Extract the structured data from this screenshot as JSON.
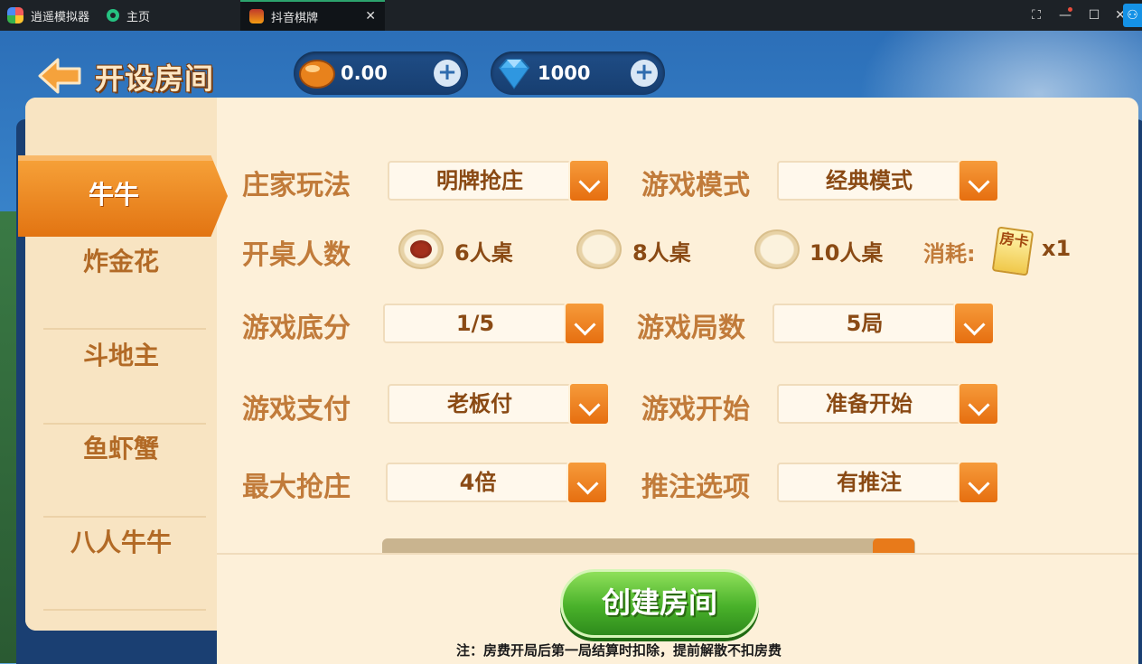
{
  "emulator": {
    "app_name": "逍遥模拟器",
    "tabs": [
      {
        "label": "主页"
      },
      {
        "label": "抖音棋牌"
      }
    ],
    "close_glyph": "✕",
    "window_controls": {
      "fullscreen": "⛶",
      "minimize": "—",
      "maximize": "☐",
      "close": "✕",
      "side": "⚇"
    }
  },
  "header": {
    "title": "开设房间",
    "beans": {
      "value": "0.00",
      "plus": "+"
    },
    "gems": {
      "value": "1000",
      "plus": "+"
    }
  },
  "sidebar": {
    "items": [
      {
        "label": "牛牛",
        "active": true
      },
      {
        "label": "炸金花"
      },
      {
        "label": "斗地主"
      },
      {
        "label": "鱼虾蟹"
      },
      {
        "label": "八人牛牛"
      }
    ]
  },
  "settings": {
    "banker_mode": {
      "label": "庄家玩法",
      "value": "明牌抢庄"
    },
    "game_mode": {
      "label": "游戏模式",
      "value": "经典模式"
    },
    "table_size": {
      "label": "开桌人数",
      "options": [
        "6人桌",
        "8人桌",
        "10人桌"
      ],
      "selected": 0
    },
    "cost": {
      "label": "消耗:",
      "card_text": "房卡",
      "count": "x1"
    },
    "base_score": {
      "label": "游戏底分",
      "value": "1/5"
    },
    "rounds": {
      "label": "游戏局数",
      "value": "5局"
    },
    "payment": {
      "label": "游戏支付",
      "value": "老板付"
    },
    "start": {
      "label": "游戏开始",
      "value": "准备开始"
    },
    "max_grab": {
      "label": "最大抢庄",
      "value": "4倍"
    },
    "push_bet": {
      "label": "推注选项",
      "value": "有推注"
    }
  },
  "footer": {
    "create_button": "创建房间",
    "note": "注：房费开局后第一局结算时扣除，提前解散不扣房费"
  },
  "colors": {
    "label": "#c17b3a",
    "value": "#8a4a14",
    "accent_orange": "#e87a1a",
    "create_green": "#49b12a"
  }
}
